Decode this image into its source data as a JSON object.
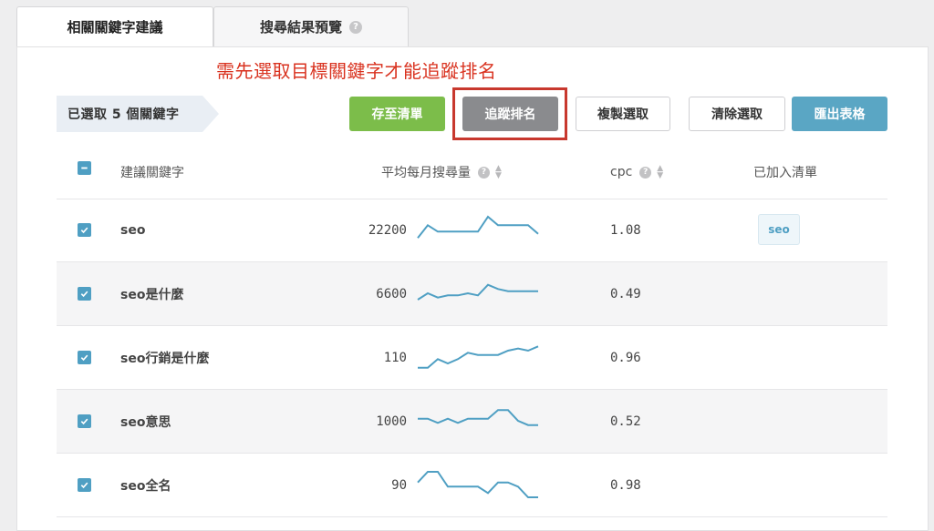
{
  "tabs": [
    {
      "label": "相關關鍵字建議",
      "active": true
    },
    {
      "label": "搜尋結果預覽",
      "active": false
    }
  ],
  "help_icon": "question-mark-icon",
  "annotation": "需先選取目標關鍵字才能追蹤排名",
  "selection": {
    "label": "已選取  5  個關鍵字"
  },
  "toolbar": {
    "save_list": "存至清單",
    "track_rank": "追蹤排名",
    "copy_selected": "複製選取",
    "clear_selected": "清除選取",
    "export": "匯出表格"
  },
  "colors": {
    "green": "#7cbd4a",
    "gray": "#8a8b8e",
    "blue": "#5aa6c4",
    "accent": "#4f9fc3",
    "annotation": "#d9321f"
  },
  "table": {
    "columns": {
      "keyword": "建議關鍵字",
      "volume": "平均每月搜尋量",
      "cpc": "cpc",
      "in_list": "已加入清單"
    },
    "rows": [
      {
        "keyword": "seo",
        "volume": "22200",
        "cpc": "1.08",
        "in_list": "seo",
        "trend": [
          2,
          8,
          5,
          5,
          5,
          5,
          5,
          12,
          8,
          8,
          8,
          8,
          4
        ]
      },
      {
        "keyword": "seo是什麼",
        "volume": "6600",
        "cpc": "0.49",
        "in_list": "",
        "trend": [
          3,
          6,
          4,
          5,
          5,
          6,
          5,
          10,
          8,
          7,
          7,
          7,
          7
        ]
      },
      {
        "keyword": "seo行銷是什麼",
        "volume": "110",
        "cpc": "0.96",
        "in_list": "",
        "trend": [
          1,
          1,
          5,
          3,
          5,
          8,
          7,
          7,
          7,
          9,
          10,
          9,
          11
        ]
      },
      {
        "keyword": "seo意思",
        "volume": "1000",
        "cpc": "0.52",
        "in_list": "",
        "trend": [
          7,
          7,
          5,
          7,
          5,
          7,
          7,
          7,
          11,
          11,
          6,
          4,
          4
        ]
      },
      {
        "keyword": "seo全名",
        "volume": "90",
        "cpc": "0.98",
        "in_list": "",
        "trend": [
          7,
          12,
          12,
          5,
          5,
          5,
          5,
          2,
          7,
          7,
          5,
          0,
          0
        ]
      }
    ]
  }
}
